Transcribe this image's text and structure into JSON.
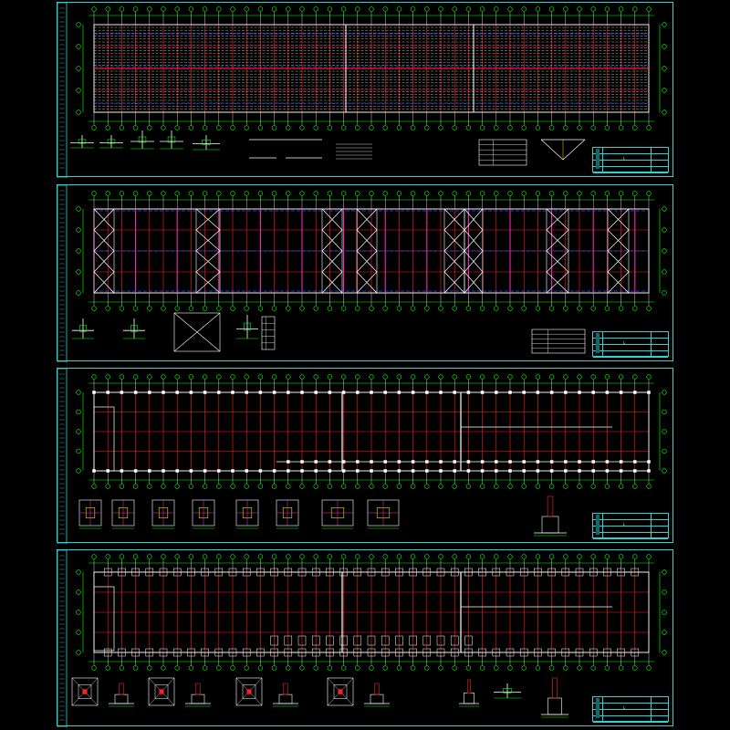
{
  "drawing": {
    "sheets": [
      {
        "id": "roof-purlin-plan",
        "title_mark": "L"
      },
      {
        "id": "roof-bracing-plan",
        "title_mark": "L"
      },
      {
        "id": "column-layout-plan",
        "title_mark": "L"
      },
      {
        "id": "foundation-plan",
        "title_mark": "L"
      }
    ]
  },
  "colors": {
    "frame": "#2ad4d4",
    "grid": "#ff2020",
    "axis": "#00ff00",
    "magenta": "#ff30c0",
    "blue": "#3050ff",
    "white": "#ffffff",
    "yellow": "#e6e600"
  }
}
